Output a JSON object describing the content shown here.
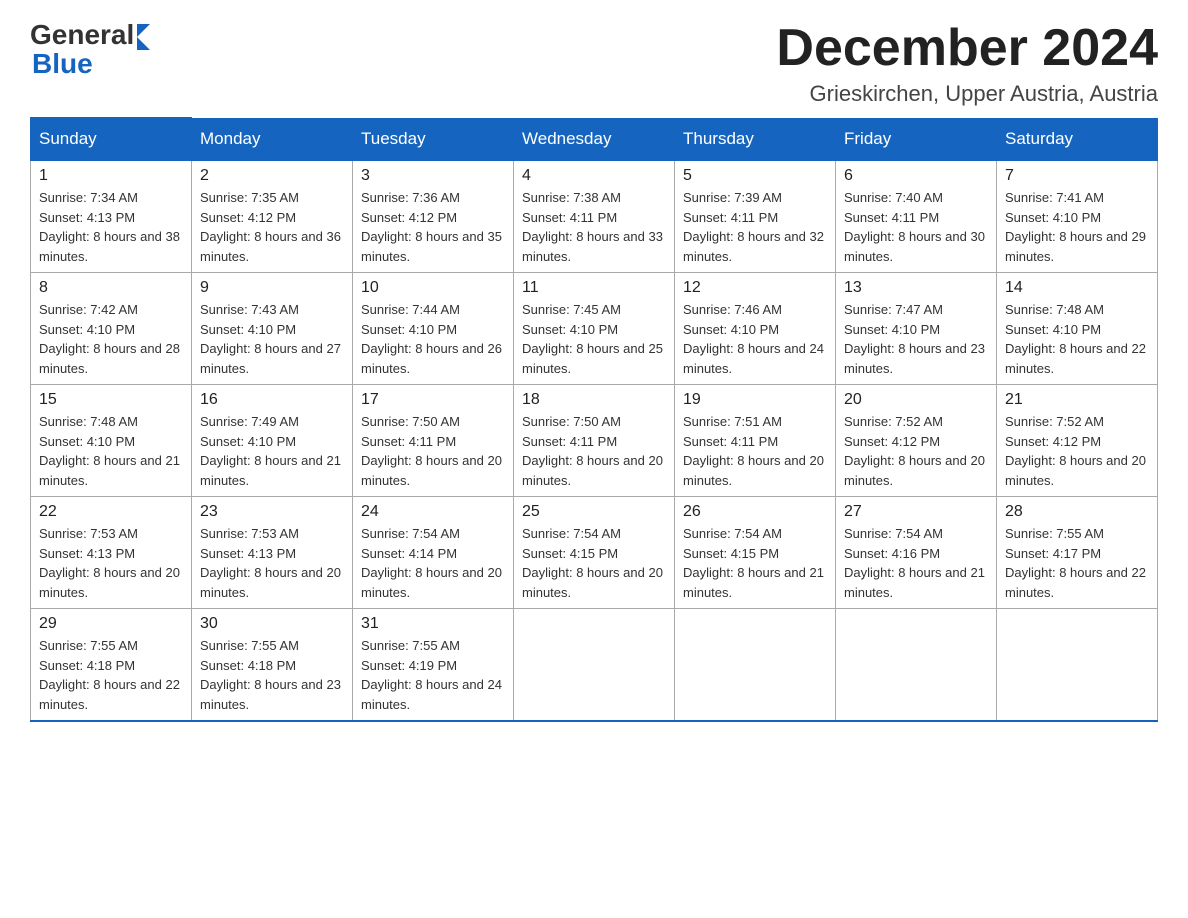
{
  "header": {
    "logo_general": "General",
    "logo_blue": "Blue",
    "month_title": "December 2024",
    "location": "Grieskirchen, Upper Austria, Austria"
  },
  "weekdays": [
    "Sunday",
    "Monday",
    "Tuesday",
    "Wednesday",
    "Thursday",
    "Friday",
    "Saturday"
  ],
  "weeks": [
    [
      {
        "day": "1",
        "sunrise": "7:34 AM",
        "sunset": "4:13 PM",
        "daylight": "8 hours and 38 minutes."
      },
      {
        "day": "2",
        "sunrise": "7:35 AM",
        "sunset": "4:12 PM",
        "daylight": "8 hours and 36 minutes."
      },
      {
        "day": "3",
        "sunrise": "7:36 AM",
        "sunset": "4:12 PM",
        "daylight": "8 hours and 35 minutes."
      },
      {
        "day": "4",
        "sunrise": "7:38 AM",
        "sunset": "4:11 PM",
        "daylight": "8 hours and 33 minutes."
      },
      {
        "day": "5",
        "sunrise": "7:39 AM",
        "sunset": "4:11 PM",
        "daylight": "8 hours and 32 minutes."
      },
      {
        "day": "6",
        "sunrise": "7:40 AM",
        "sunset": "4:11 PM",
        "daylight": "8 hours and 30 minutes."
      },
      {
        "day": "7",
        "sunrise": "7:41 AM",
        "sunset": "4:10 PM",
        "daylight": "8 hours and 29 minutes."
      }
    ],
    [
      {
        "day": "8",
        "sunrise": "7:42 AM",
        "sunset": "4:10 PM",
        "daylight": "8 hours and 28 minutes."
      },
      {
        "day": "9",
        "sunrise": "7:43 AM",
        "sunset": "4:10 PM",
        "daylight": "8 hours and 27 minutes."
      },
      {
        "day": "10",
        "sunrise": "7:44 AM",
        "sunset": "4:10 PM",
        "daylight": "8 hours and 26 minutes."
      },
      {
        "day": "11",
        "sunrise": "7:45 AM",
        "sunset": "4:10 PM",
        "daylight": "8 hours and 25 minutes."
      },
      {
        "day": "12",
        "sunrise": "7:46 AM",
        "sunset": "4:10 PM",
        "daylight": "8 hours and 24 minutes."
      },
      {
        "day": "13",
        "sunrise": "7:47 AM",
        "sunset": "4:10 PM",
        "daylight": "8 hours and 23 minutes."
      },
      {
        "day": "14",
        "sunrise": "7:48 AM",
        "sunset": "4:10 PM",
        "daylight": "8 hours and 22 minutes."
      }
    ],
    [
      {
        "day": "15",
        "sunrise": "7:48 AM",
        "sunset": "4:10 PM",
        "daylight": "8 hours and 21 minutes."
      },
      {
        "day": "16",
        "sunrise": "7:49 AM",
        "sunset": "4:10 PM",
        "daylight": "8 hours and 21 minutes."
      },
      {
        "day": "17",
        "sunrise": "7:50 AM",
        "sunset": "4:11 PM",
        "daylight": "8 hours and 20 minutes."
      },
      {
        "day": "18",
        "sunrise": "7:50 AM",
        "sunset": "4:11 PM",
        "daylight": "8 hours and 20 minutes."
      },
      {
        "day": "19",
        "sunrise": "7:51 AM",
        "sunset": "4:11 PM",
        "daylight": "8 hours and 20 minutes."
      },
      {
        "day": "20",
        "sunrise": "7:52 AM",
        "sunset": "4:12 PM",
        "daylight": "8 hours and 20 minutes."
      },
      {
        "day": "21",
        "sunrise": "7:52 AM",
        "sunset": "4:12 PM",
        "daylight": "8 hours and 20 minutes."
      }
    ],
    [
      {
        "day": "22",
        "sunrise": "7:53 AM",
        "sunset": "4:13 PM",
        "daylight": "8 hours and 20 minutes."
      },
      {
        "day": "23",
        "sunrise": "7:53 AM",
        "sunset": "4:13 PM",
        "daylight": "8 hours and 20 minutes."
      },
      {
        "day": "24",
        "sunrise": "7:54 AM",
        "sunset": "4:14 PM",
        "daylight": "8 hours and 20 minutes."
      },
      {
        "day": "25",
        "sunrise": "7:54 AM",
        "sunset": "4:15 PM",
        "daylight": "8 hours and 20 minutes."
      },
      {
        "day": "26",
        "sunrise": "7:54 AM",
        "sunset": "4:15 PM",
        "daylight": "8 hours and 21 minutes."
      },
      {
        "day": "27",
        "sunrise": "7:54 AM",
        "sunset": "4:16 PM",
        "daylight": "8 hours and 21 minutes."
      },
      {
        "day": "28",
        "sunrise": "7:55 AM",
        "sunset": "4:17 PM",
        "daylight": "8 hours and 22 minutes."
      }
    ],
    [
      {
        "day": "29",
        "sunrise": "7:55 AM",
        "sunset": "4:18 PM",
        "daylight": "8 hours and 22 minutes."
      },
      {
        "day": "30",
        "sunrise": "7:55 AM",
        "sunset": "4:18 PM",
        "daylight": "8 hours and 23 minutes."
      },
      {
        "day": "31",
        "sunrise": "7:55 AM",
        "sunset": "4:19 PM",
        "daylight": "8 hours and 24 minutes."
      },
      null,
      null,
      null,
      null
    ]
  ]
}
